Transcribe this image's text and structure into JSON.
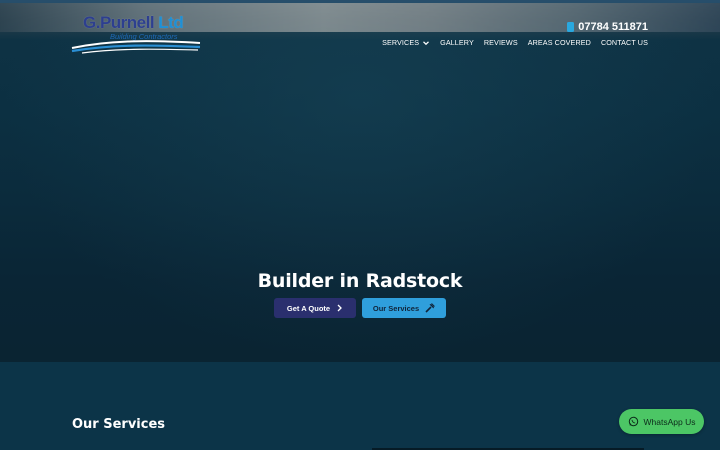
{
  "logo": {
    "name": "G.Purnell",
    "ltd": " Ltd",
    "tagline": "Building Contractors"
  },
  "header": {
    "phone": "07784 511871",
    "phone_icon": "phone-icon",
    "nav": [
      {
        "label": "SERVICES",
        "has_dropdown": true
      },
      {
        "label": "GALLERY"
      },
      {
        "label": "REVIEWS"
      },
      {
        "label": "AREAS COVERED"
      },
      {
        "label": "CONTACT US"
      }
    ]
  },
  "hero": {
    "title": "Builder in Radstock",
    "quote_button": "Get A Quote",
    "services_button": "Our Services"
  },
  "services": {
    "title": "Our Services"
  },
  "whatsapp": {
    "label": "WhatsApp Us"
  },
  "colors": {
    "accent_blue": "#2f9fdc",
    "navy_button": "#2a2f6e",
    "whatsapp_green": "#4cc665",
    "background": "#0b3246"
  }
}
